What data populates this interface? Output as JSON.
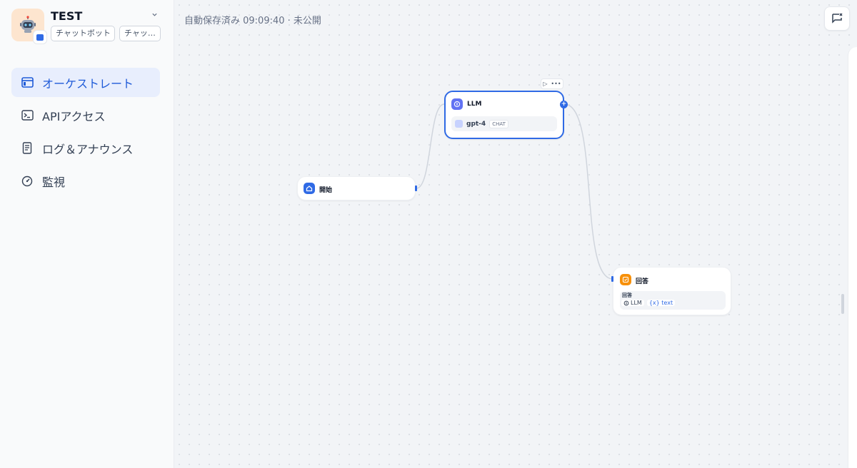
{
  "app": {
    "name": "TEST",
    "tags": [
      "チャットボット",
      "チャッ…"
    ]
  },
  "nav": {
    "items": [
      {
        "label": "オーケストレート",
        "icon": "browser-window-icon",
        "active": true
      },
      {
        "label": "APIアクセス",
        "icon": "terminal-icon",
        "active": false
      },
      {
        "label": "ログ＆アナウンス",
        "icon": "file-list-icon",
        "active": false
      },
      {
        "label": "監視",
        "icon": "gauge-icon",
        "active": false
      }
    ]
  },
  "header": {
    "status": "自動保存済み 09:09:40 · 未公開"
  },
  "workflow": {
    "nodes": {
      "start": {
        "title": "開始",
        "icon": "home-icon",
        "color": "#2f6ae5"
      },
      "llm": {
        "title": "LLM",
        "icon": "llm-icon",
        "color": "#6172f3",
        "model": "gpt-4",
        "mode": "CHAT"
      },
      "answer": {
        "title": "回答",
        "icon": "answer-icon",
        "color": "#f79009",
        "field_label": "回答",
        "ref_node": "LLM",
        "ref_var": "{x} text"
      }
    }
  },
  "colors": {
    "accent": "#2f6ae5",
    "active_nav_bg": "#e8eefd"
  }
}
